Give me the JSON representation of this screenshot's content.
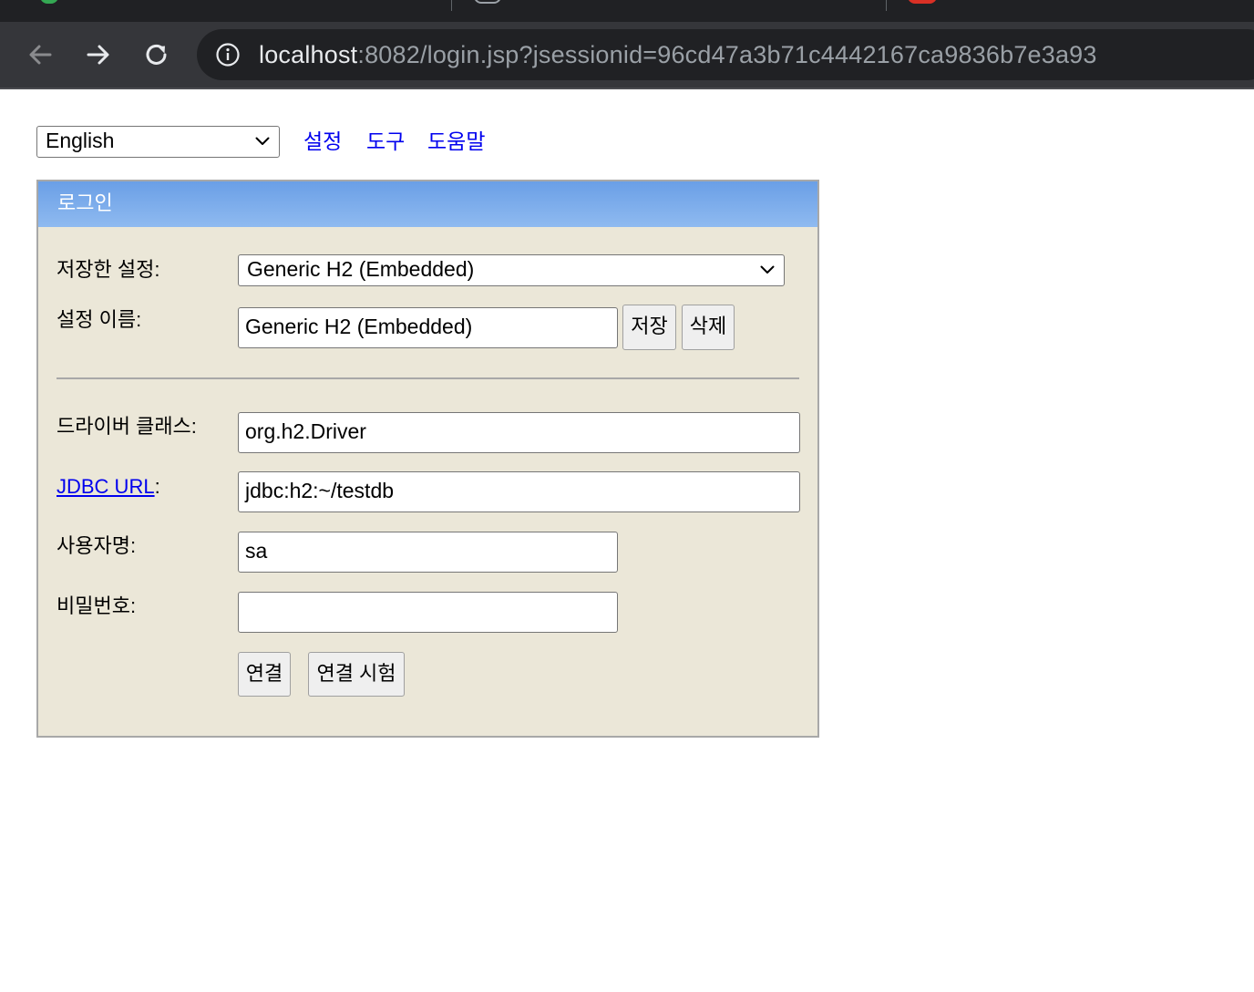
{
  "browser": {
    "url_host": "localhost",
    "url_rest": ":8082/login.jsp?jsessionid=96cd47a3b71c4442167ca9836b7e3a93"
  },
  "topbar": {
    "language_selected": "English",
    "links": [
      "설정",
      "도구",
      "도움말"
    ]
  },
  "login_panel": {
    "title": "로그인",
    "saved_settings_label": "저장한 설정:",
    "saved_settings_value": "Generic H2 (Embedded)",
    "setting_name_label": "설정 이름:",
    "setting_name_value": "Generic H2 (Embedded)",
    "save_button": "저장",
    "delete_button": "삭제",
    "driver_class_label": "드라이버 클래스:",
    "driver_class_value": "org.h2.Driver",
    "jdbc_url_link": "JDBC URL",
    "jdbc_url_colon": ":",
    "jdbc_url_value": "jdbc:h2:~/testdb",
    "username_label": "사용자명:",
    "username_value": "sa",
    "password_label": "비밀번호:",
    "password_value": "",
    "connect_button": "연결",
    "test_connection_button": "연결 시험"
  },
  "colors": {
    "panel_background": "#ebe7d8",
    "panel_header": "#7aaaeb",
    "link": "#0000ee",
    "chrome_toolbar": "#35363a"
  }
}
